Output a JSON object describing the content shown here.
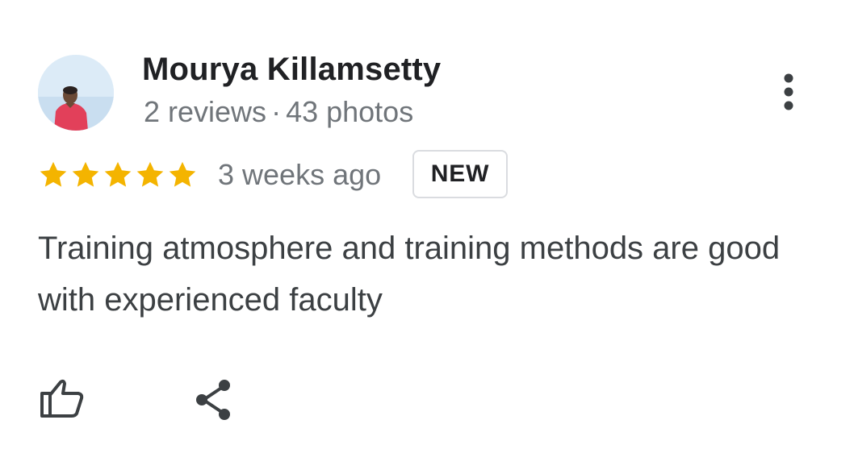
{
  "review": {
    "author": "Mourya Killamsetty",
    "reviews_count": "2 reviews",
    "separator": "·",
    "photos_count": "43 photos",
    "rating": 5,
    "rating_max": 5,
    "time_ago": "3 weeks ago",
    "badge": "NEW",
    "text": "Training atmosphere and training methods are good with experienced faculty"
  },
  "icons": {
    "more": "more-vert-icon",
    "like": "thumb-up-icon",
    "share": "share-icon"
  },
  "colors": {
    "star": "#f4b400",
    "primary_text": "#202124",
    "secondary_text": "#70757a",
    "body_text": "#3c4043",
    "badge_border": "#dadce0"
  }
}
